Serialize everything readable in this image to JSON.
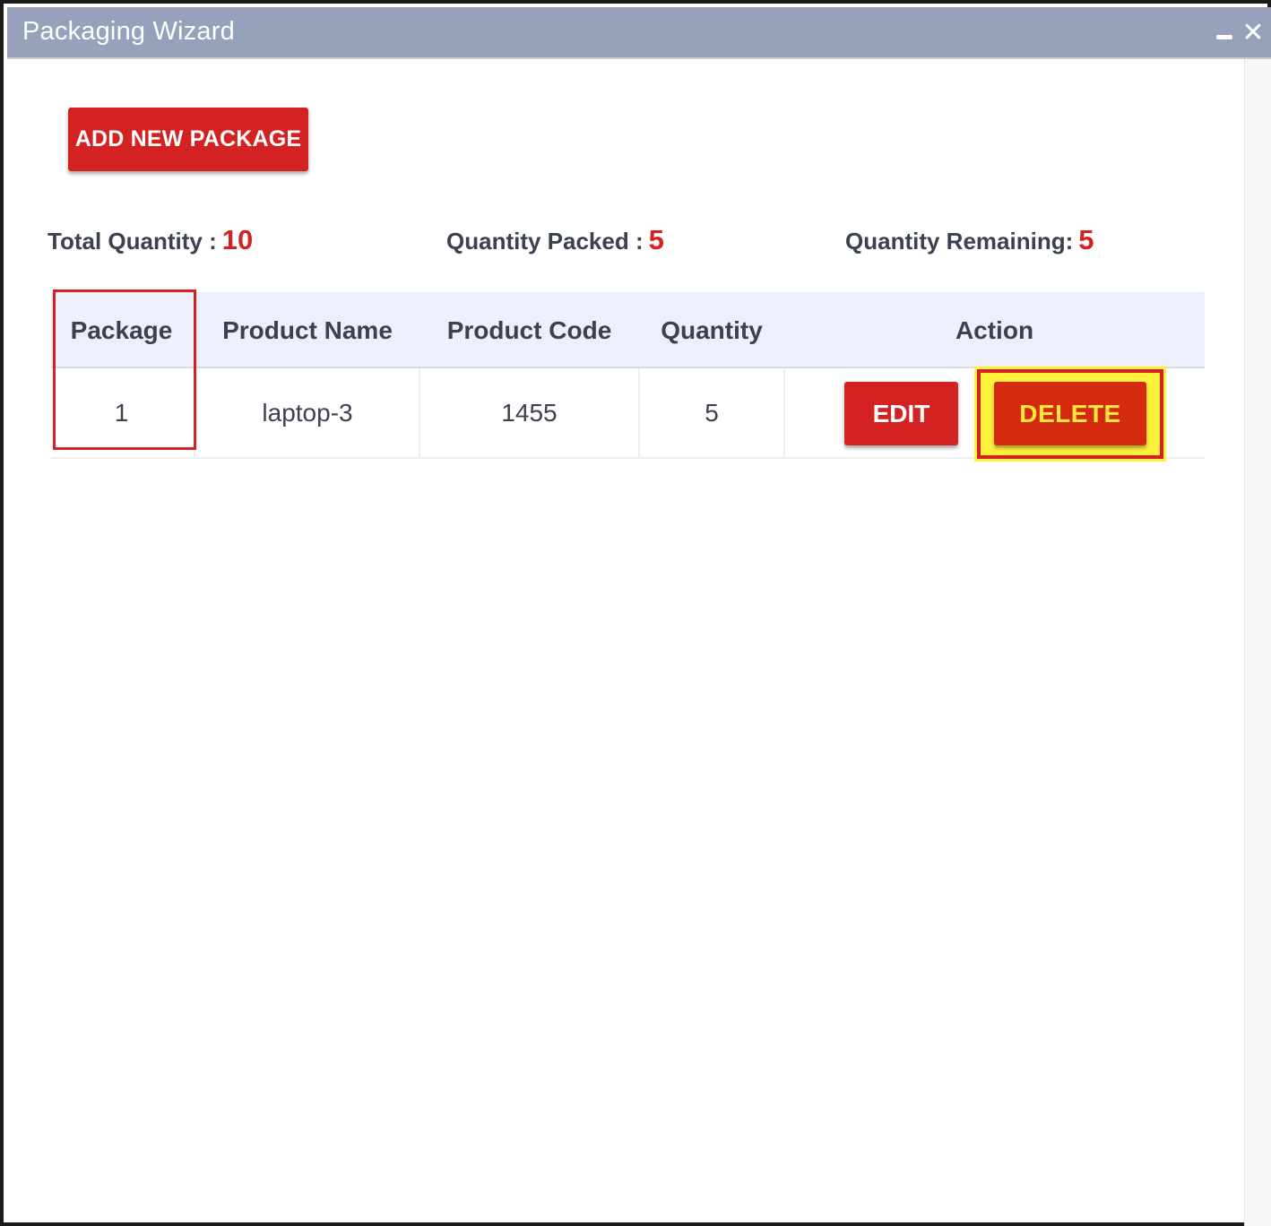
{
  "window": {
    "title": "Packaging Wizard",
    "minimize_icon": "minimize-icon",
    "close_glyph": "✕"
  },
  "toolbar": {
    "add_label": "ADD NEW PACKAGE"
  },
  "summary": {
    "total_label": "Total Quantity :",
    "total_value": "10",
    "packed_label": "Quantity Packed :",
    "packed_value": "5",
    "remaining_label": "Quantity Remaining:",
    "remaining_value": "5"
  },
  "table": {
    "columns": [
      "Package",
      "Product Name",
      "Product Code",
      "Quantity",
      "Action"
    ],
    "rows": [
      {
        "package": "1",
        "product_name": "laptop-3",
        "product_code": "1455",
        "quantity": "5",
        "edit_label": "EDIT",
        "delete_label": "DELETE"
      }
    ]
  },
  "colors": {
    "titlebar": "#98a1bb",
    "accent_red": "#d42222",
    "highlight_yellow": "#fff23a",
    "header_bg": "#edf0fa",
    "text": "#3c4150"
  }
}
